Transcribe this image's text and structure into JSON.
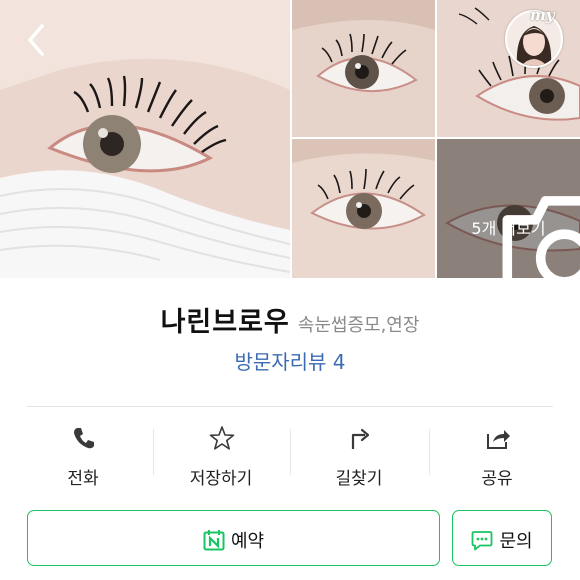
{
  "gallery": {
    "more_label": "5개 더보기",
    "badge_text": "my",
    "photos": [
      "main-eye-photo",
      "eye-photo-2",
      "eye-photo-3",
      "eye-photo-4",
      "eye-photo-5"
    ]
  },
  "place": {
    "name": "나린브로우",
    "category": "속눈썹증모,연장",
    "review_link": "방문자리뷰 4"
  },
  "actions": [
    {
      "label": "전화",
      "icon": "phone-icon"
    },
    {
      "label": "저장하기",
      "icon": "star-icon"
    },
    {
      "label": "길찾기",
      "icon": "directions-icon"
    },
    {
      "label": "공유",
      "icon": "share-icon"
    }
  ],
  "buttons": {
    "reserve_label": "예약",
    "reserve_icon": "naver-calendar-icon",
    "inquiry_label": "문의",
    "inquiry_icon": "chat-icon"
  },
  "colors": {
    "accent_green": "#19c463",
    "link_blue": "#3d6bb3",
    "text_dark": "#111111",
    "text_gray": "#8a8a8a"
  }
}
